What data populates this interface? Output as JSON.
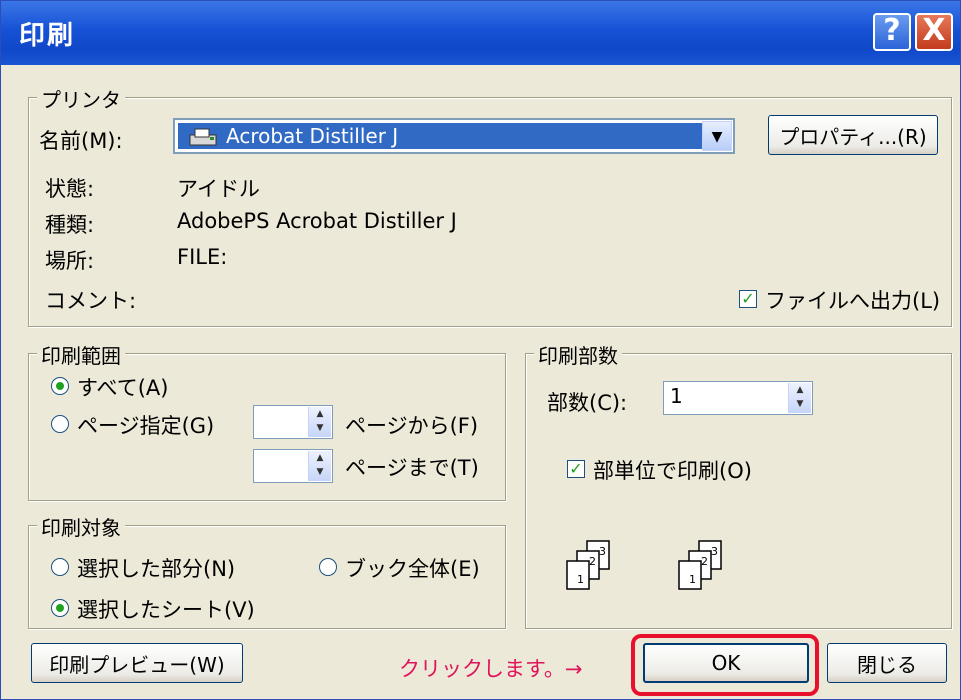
{
  "window": {
    "title": "印刷"
  },
  "titlebar_buttons": {
    "help": "?",
    "close": "X"
  },
  "printer": {
    "group_label": "プリンタ",
    "name_label": "名前(M):",
    "name_value": "Acrobat Distiller J",
    "properties_button": "プロパティ...(R)",
    "status_label": "状態:",
    "status_value": "アイドル",
    "type_label": "種類:",
    "type_value": "AdobePS Acrobat Distiller J",
    "location_label": "場所:",
    "location_value": "FILE:",
    "comment_label": "コメント:",
    "print_to_file_label": "ファイルへ出力(L)",
    "print_to_file_checked": true
  },
  "range": {
    "group_label": "印刷範囲",
    "all_label": "すべて(A)",
    "pages_label": "ページ指定(G)",
    "from_label": "ページから(F)",
    "to_label": "ページまで(T)",
    "selected": "all"
  },
  "copies": {
    "group_label": "印刷部数",
    "count_label": "部数(C):",
    "count_value": "1",
    "collate_label": "部単位で印刷(O)",
    "collate_checked": true
  },
  "target": {
    "group_label": "印刷対象",
    "selection_label": "選択した部分(N)",
    "workbook_label": "ブック全体(E)",
    "sheets_label": "選択したシート(V)",
    "selected": "sheets"
  },
  "footer": {
    "preview_button": "印刷プレビュー(W)",
    "annotation": "クリックします。→",
    "ok_button": "OK",
    "close_button": "閉じる"
  },
  "colors": {
    "annotation": "#e0145a",
    "highlight": "#e8102c",
    "selection": "#316ac5"
  }
}
